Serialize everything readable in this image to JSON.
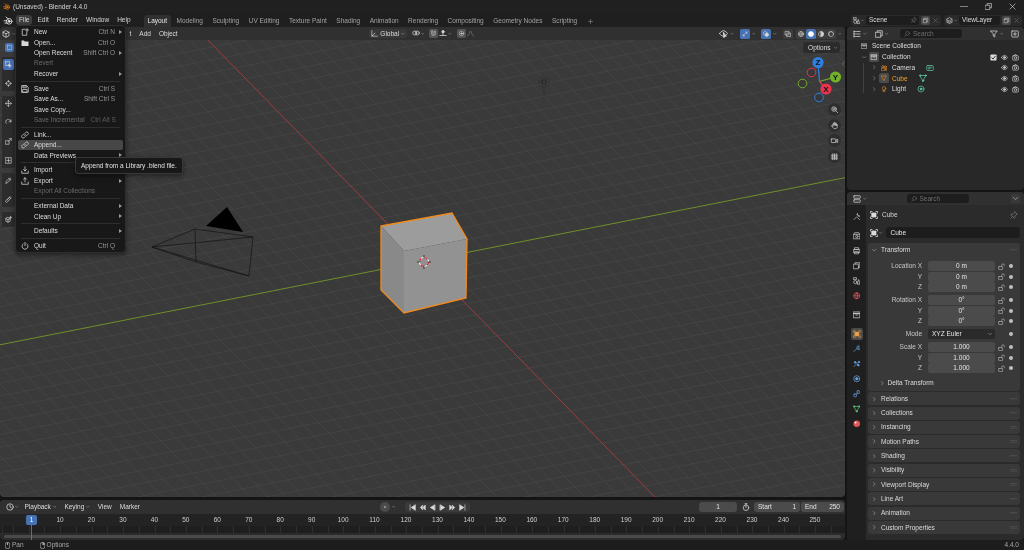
{
  "window": {
    "title": "(Unsaved) - Blender 4.4.0"
  },
  "menu_bar": [
    {
      "label": "File",
      "selected": true
    },
    {
      "label": "Edit",
      "selected": false
    },
    {
      "label": "Render",
      "selected": false
    },
    {
      "label": "Window",
      "selected": false
    },
    {
      "label": "Help",
      "selected": false
    }
  ],
  "workspaces": [
    {
      "label": "Layout",
      "selected": true
    },
    {
      "label": "Modeling",
      "selected": false
    },
    {
      "label": "Sculpting",
      "selected": false
    },
    {
      "label": "UV Editing",
      "selected": false
    },
    {
      "label": "Texture Paint",
      "selected": false
    },
    {
      "label": "Shading",
      "selected": false
    },
    {
      "label": "Animation",
      "selected": false
    },
    {
      "label": "Rendering",
      "selected": false
    },
    {
      "label": "Compositing",
      "selected": false
    },
    {
      "label": "Geometry Nodes",
      "selected": false
    },
    {
      "label": "Scripting",
      "selected": false
    }
  ],
  "scene_selector": {
    "value": "Scene"
  },
  "view_layer_selector": {
    "value": "ViewLayer"
  },
  "viewport": {
    "header_menus": [
      "t",
      "Add",
      "Object"
    ],
    "transform_orientation": "Global",
    "snapping": false,
    "proportional_editing": false,
    "gizmos": true,
    "overlays": true,
    "xray": false,
    "shading_modes": [
      {
        "selected": false
      },
      {
        "selected": true
      },
      {
        "selected": false
      },
      {
        "selected": false
      }
    ],
    "select_mode_button": {
      "selected": true
    },
    "tool_groups": [
      {
        "tools": [
          {
            "selected": true
          },
          {
            "selected": false
          }
        ]
      },
      {
        "tools": [
          {
            "selected": false
          },
          {
            "selected": false
          },
          {
            "selected": false
          },
          {
            "selected": false
          }
        ]
      },
      {
        "tools": [
          {
            "selected": false
          },
          {
            "selected": false
          }
        ]
      },
      {
        "tools": [
          {
            "selected": false
          }
        ]
      }
    ],
    "options_button": "Options",
    "gizmo_axes": [
      {
        "label": "Z",
        "color": "#2f7fe0"
      },
      {
        "label": "Y",
        "color": "#72b12a"
      },
      {
        "label": "X",
        "color": "#e8354f"
      }
    ]
  },
  "file_menu": {
    "sections": [
      {
        "items": [
          {
            "label": "New",
            "shortcut": "Ctrl N",
            "submenu": true,
            "disabled": false,
            "highlighted": false
          },
          {
            "label": "Open...",
            "shortcut": "Ctrl O",
            "submenu": false,
            "disabled": false,
            "highlighted": false
          },
          {
            "label": "Open Recent",
            "shortcut": "Shift Ctrl O",
            "submenu": true,
            "disabled": false,
            "highlighted": false
          },
          {
            "label": "Revert",
            "submenu": false,
            "disabled": true,
            "highlighted": false
          },
          {
            "label": "Recover",
            "submenu": true,
            "disabled": false,
            "highlighted": false
          }
        ]
      },
      {
        "items": [
          {
            "label": "Save",
            "shortcut": "Ctrl S",
            "submenu": false,
            "disabled": false,
            "highlighted": false
          },
          {
            "label": "Save As...",
            "shortcut": "Shift Ctrl S",
            "submenu": false,
            "disabled": false,
            "highlighted": false
          },
          {
            "label": "Save Copy...",
            "submenu": false,
            "disabled": false,
            "highlighted": false
          },
          {
            "label": "Save Incremental",
            "shortcut": "Ctrl Alt S",
            "submenu": false,
            "disabled": true,
            "highlighted": false
          }
        ]
      },
      {
        "items": [
          {
            "label": "Link...",
            "submenu": false,
            "disabled": false,
            "highlighted": false
          },
          {
            "label": "Append...",
            "submenu": false,
            "disabled": false,
            "highlighted": true
          },
          {
            "label": "Data Previews",
            "submenu": true,
            "disabled": false,
            "highlighted": false
          }
        ]
      },
      {
        "items": [
          {
            "label": "Import",
            "submenu": false,
            "disabled": false,
            "highlighted": false
          },
          {
            "label": "Export",
            "submenu": true,
            "disabled": false,
            "highlighted": false
          },
          {
            "label": "Export All Collections",
            "submenu": false,
            "disabled": true,
            "highlighted": false
          }
        ]
      },
      {
        "items": [
          {
            "label": "External Data",
            "submenu": true,
            "disabled": false,
            "highlighted": false
          },
          {
            "label": "Clean Up",
            "submenu": true,
            "disabled": false,
            "highlighted": false
          }
        ]
      },
      {
        "items": [
          {
            "label": "Defaults",
            "submenu": true,
            "disabled": false,
            "highlighted": false
          }
        ]
      },
      {
        "items": [
          {
            "label": "Quit",
            "shortcut": "Ctrl Q",
            "submenu": false,
            "disabled": false,
            "highlighted": false
          }
        ]
      }
    ]
  },
  "tooltip": {
    "text": "Append from a Library .blend file."
  },
  "outliner": {
    "search": {
      "placeholder": "Search"
    },
    "tree": [
      {
        "label": "Scene Collection",
        "kind": "scene_collection",
        "selected": false,
        "active": false,
        "children": [
          {
            "label": "Collection",
            "kind": "collection",
            "expanded": true,
            "checked": true,
            "selected": false,
            "active": true,
            "children": [
              {
                "label": "Camera",
                "kind": "camera",
                "expanded": false,
                "selected": false,
                "active": false
              },
              {
                "label": "Cube",
                "kind": "mesh",
                "expanded": false,
                "selected": true,
                "active": true
              },
              {
                "label": "Light",
                "kind": "light",
                "expanded": false,
                "selected": false,
                "active": false
              }
            ]
          }
        ]
      }
    ]
  },
  "properties": {
    "search": {
      "placeholder": "Search"
    },
    "tab_groups": [
      {
        "tabs": [
          {
            "selected": false
          }
        ]
      },
      {
        "tabs": [
          {
            "selected": false
          },
          {
            "selected": false
          },
          {
            "selected": false
          },
          {
            "selected": false
          },
          {
            "selected": false
          }
        ]
      },
      {
        "tabs": [
          {
            "selected": false
          }
        ]
      },
      {
        "tabs": [
          {
            "selected": true
          },
          {
            "selected": false
          },
          {
            "selected": false
          },
          {
            "selected": false
          },
          {
            "selected": false
          },
          {
            "selected": false
          },
          {
            "selected": false
          }
        ]
      }
    ],
    "object_name": "Cube",
    "name_field": {
      "value": "Cube"
    },
    "transform": {
      "title": "Transform",
      "expanded": true,
      "groups": [
        {
          "rows": [
            {
              "label": "Location X",
              "value": "0 m",
              "kind": "number"
            },
            {
              "label": "Y",
              "value": "0 m",
              "kind": "number"
            },
            {
              "label": "Z",
              "value": "0 m",
              "kind": "number"
            }
          ]
        },
        {
          "rows": [
            {
              "label": "Rotation X",
              "value": "0°",
              "kind": "number"
            },
            {
              "label": "Y",
              "value": "0°",
              "kind": "number"
            },
            {
              "label": "Z",
              "value": "0°",
              "kind": "number"
            }
          ]
        },
        {
          "rows": [
            {
              "label": "Mode",
              "value": "XYZ Euler",
              "kind": "dropdown"
            }
          ]
        },
        {
          "rows": [
            {
              "label": "Scale X",
              "value": "1.000",
              "kind": "number"
            },
            {
              "label": "Y",
              "value": "1.000",
              "kind": "number"
            },
            {
              "label": "Z",
              "value": "1.000",
              "kind": "number"
            }
          ]
        }
      ],
      "subpanels": [
        {
          "title": "Delta Transform",
          "expanded": false
        }
      ]
    },
    "panels": [
      {
        "title": "Relations",
        "expanded": false
      },
      {
        "title": "Collections",
        "expanded": false
      },
      {
        "title": "Instancing",
        "expanded": false
      },
      {
        "title": "Motion Paths",
        "expanded": false
      },
      {
        "title": "Shading",
        "expanded": false
      },
      {
        "title": "Visibility",
        "expanded": false
      },
      {
        "title": "Viewport Display",
        "expanded": false
      },
      {
        "title": "Line Art",
        "expanded": false
      },
      {
        "title": "Animation",
        "expanded": false
      },
      {
        "title": "Custom Properties",
        "expanded": false
      }
    ]
  },
  "timeline": {
    "menus": [
      {
        "label": "Playback",
        "dropdown": true
      },
      {
        "label": "Keying",
        "dropdown": true
      },
      {
        "label": "View",
        "dropdown": false
      },
      {
        "label": "Marker",
        "dropdown": false
      }
    ],
    "auto_keying": false,
    "current_frame": "1",
    "start": {
      "label": "Start",
      "value": "1"
    },
    "end": {
      "label": "End",
      "value": "250"
    },
    "frame_indicator": "1",
    "ruler": [
      "10",
      "20",
      "30",
      "40",
      "50",
      "60",
      "70",
      "80",
      "90",
      "100",
      "110",
      "120",
      "130",
      "140",
      "150",
      "160",
      "170",
      "180",
      "190",
      "200",
      "210",
      "220",
      "230",
      "240",
      "250"
    ]
  },
  "status_bar": {
    "hints": [
      "Pan",
      "Options"
    ],
    "version": "4.4.0"
  }
}
